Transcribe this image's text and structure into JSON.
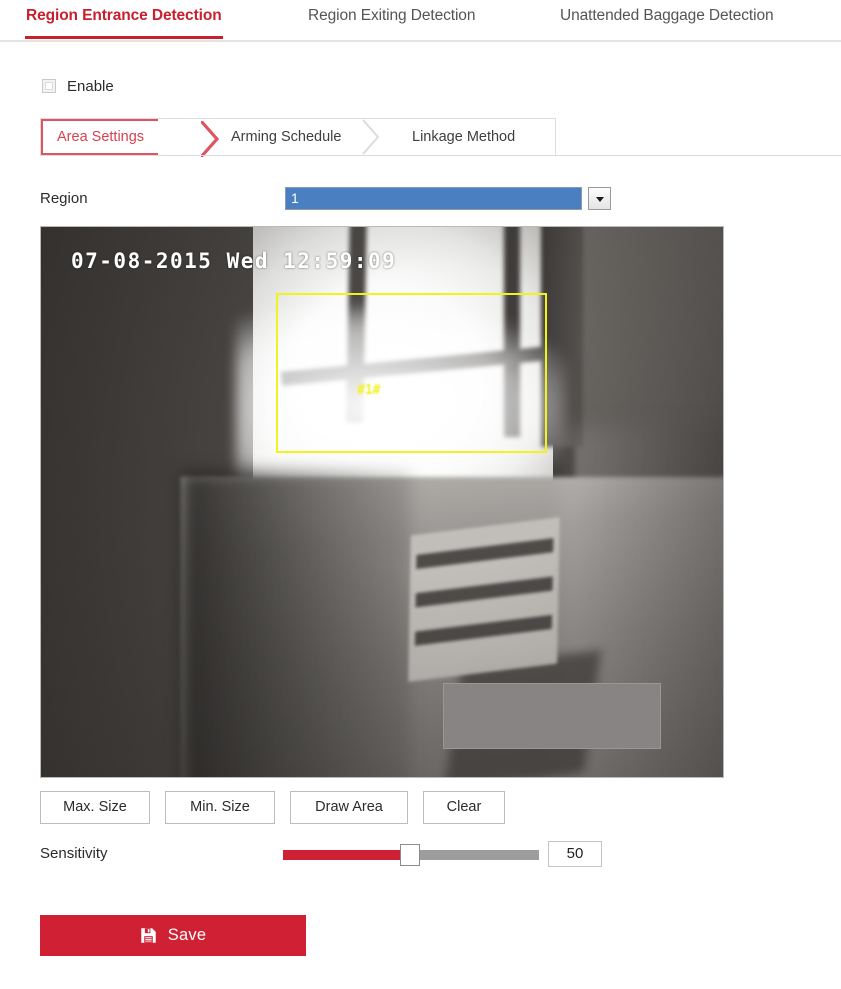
{
  "top_tabs": [
    {
      "label": "Region Entrance Detection",
      "active": true
    },
    {
      "label": "Region Exiting Detection",
      "active": false
    },
    {
      "label": "Unattended Baggage Detection",
      "active": false
    }
  ],
  "enable": {
    "label": "Enable",
    "checked": false
  },
  "sub_tabs": [
    {
      "label": "Area Settings",
      "active": true
    },
    {
      "label": "Arming Schedule",
      "active": false
    },
    {
      "label": "Linkage Method",
      "active": false
    }
  ],
  "region": {
    "label": "Region",
    "selected_value": "1",
    "options": [
      "1"
    ],
    "dropdown_icon": "chevron-down-icon"
  },
  "video": {
    "osd_timestamp": "07-08-2015 Wed 12:59:09",
    "region_rect_label": "#1#"
  },
  "area_buttons": [
    {
      "label": "Max. Size"
    },
    {
      "label": "Min. Size"
    },
    {
      "label": "Draw Area"
    },
    {
      "label": "Clear"
    }
  ],
  "sensitivity": {
    "label": "Sensitivity",
    "value": "50",
    "min": "0",
    "max": "100"
  },
  "save": {
    "label": "Save",
    "icon": "save-floppy-icon"
  },
  "colors": {
    "accent_red": "#cf2034",
    "tab_active_red": "#c8202f",
    "select_blue": "#4a7fc1",
    "region_yellow": "#f2f21e",
    "slider_track": "#9d9d9d"
  }
}
